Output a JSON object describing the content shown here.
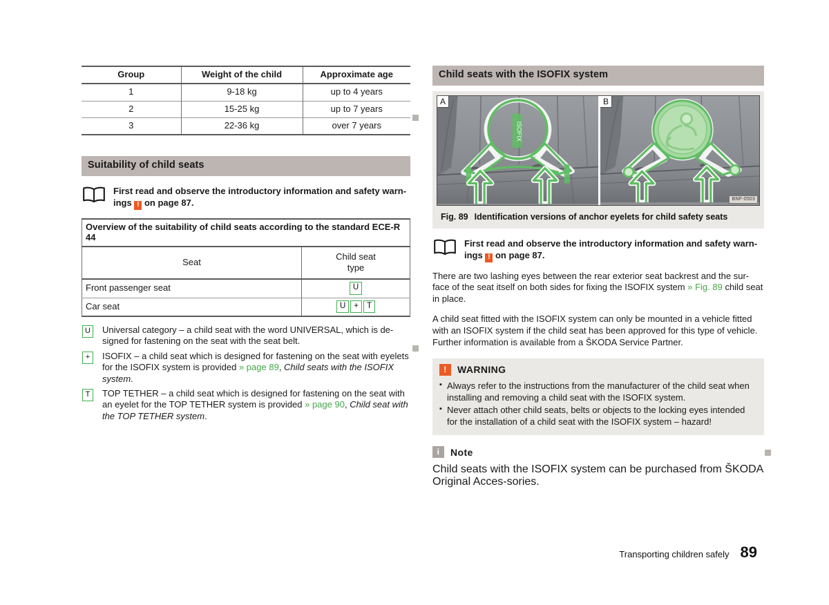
{
  "left": {
    "group_table": {
      "headers": [
        "Group",
        "Weight of the child",
        "Approximate age"
      ],
      "rows": [
        [
          "1",
          "9-18 kg",
          "up to 4 years"
        ],
        [
          "2",
          "15-25 kg",
          "up to 7 years"
        ],
        [
          "3",
          "22-36 kg",
          "over 7 years"
        ]
      ]
    },
    "section_heading": "Suitability of child seats",
    "read_first": {
      "line1": "First read and observe the introductory information and safety warn-",
      "line2_pre": "ings",
      "warn_glyph": "!",
      "line2_post": "on page 87."
    },
    "suit_table": {
      "title": "Overview of the suitability of child seats according to the standard ECE-R 44",
      "col1": "Seat",
      "col2_line1": "Child seat",
      "col2_line2": "type",
      "rows": [
        {
          "seat": "Front passenger seat",
          "types": [
            "U"
          ]
        },
        {
          "seat": "Car seat",
          "types": [
            "U",
            "+",
            "T"
          ]
        }
      ]
    },
    "definitions": [
      {
        "key": "U",
        "segments": [
          {
            "t": "Universal category – a child seat with the word UNIVERSAL, which is de-signed for fastening on the seat with the seat belt.",
            "style": "plain"
          }
        ]
      },
      {
        "key": "+",
        "segments": [
          {
            "t": "ISOFIX – a child seat which is designed for fastening on the seat with eyelets for the ISOFIX system is provided ",
            "style": "plain"
          },
          {
            "t": "» page 89",
            "style": "ref"
          },
          {
            "t": ", ",
            "style": "plain"
          },
          {
            "t": "Child seats with the ISOFIX system",
            "style": "ital"
          },
          {
            "t": ".",
            "style": "plain"
          }
        ]
      },
      {
        "key": "T",
        "segments": [
          {
            "t": "TOP TETHER – a child seat which is designed for fastening on the seat with an eyelet for the TOP TETHER system is provided ",
            "style": "plain"
          },
          {
            "t": "» page 90",
            "style": "ref"
          },
          {
            "t": ", ",
            "style": "plain"
          },
          {
            "t": "Child seat with the TOP TETHER system",
            "style": "ital"
          },
          {
            "t": ".",
            "style": "plain"
          }
        ]
      }
    ]
  },
  "right": {
    "section_heading": "Child seats with the ISOFIX system",
    "figure": {
      "letter_a": "A",
      "letter_b": "B",
      "isofix_label": "ISOFIX",
      "code": "BNF-0503",
      "caption_number": "Fig. 89",
      "caption_text": "Identification versions of anchor eyelets for child safety seats"
    },
    "read_first": {
      "line1": "First read and observe the introductory information and safety warn-",
      "line2_pre": "ings",
      "warn_glyph": "!",
      "line2_post": "on page 87."
    },
    "para1": {
      "pre": "There are two lashing eyes between the rear exterior seat backrest and the sur-face of the seat itself on both sides for fixing the ISOFIX system ",
      "ref": "» Fig. 89",
      "post": " child seat in place."
    },
    "para2": "A child seat fitted with the ISOFIX system can only be mounted in a vehicle fitted with an ISOFIX system if the child seat has been approved for this type of vehicle. Further information is available from a ŠKODA Service Partner.",
    "warning": {
      "icon_glyph": "!",
      "title": "WARNING",
      "items": [
        "Always refer to the instructions from the manufacturer of the child seat when installing and removing a child seat with the ISOFIX system.",
        "Never attach other child seats, belts or objects to the locking eyes intended for the installation of a child seat with the ISOFIX system – hazard!"
      ]
    },
    "note": {
      "icon_glyph": "i",
      "title": "Note",
      "text": "Child seats with the ISOFIX system can be purchased from ŠKODA Original Acces-sories."
    }
  },
  "footer": {
    "chapter": "Transporting children safely",
    "page": "89"
  },
  "colors": {
    "heading_bar": "#bdb5b2",
    "panel_bg": "#ebe9e6",
    "accent_orange": "#ec5b24",
    "link_green": "#46a549",
    "badge_green": "#3faf4e",
    "marker_gray": "#b8b4b0"
  }
}
